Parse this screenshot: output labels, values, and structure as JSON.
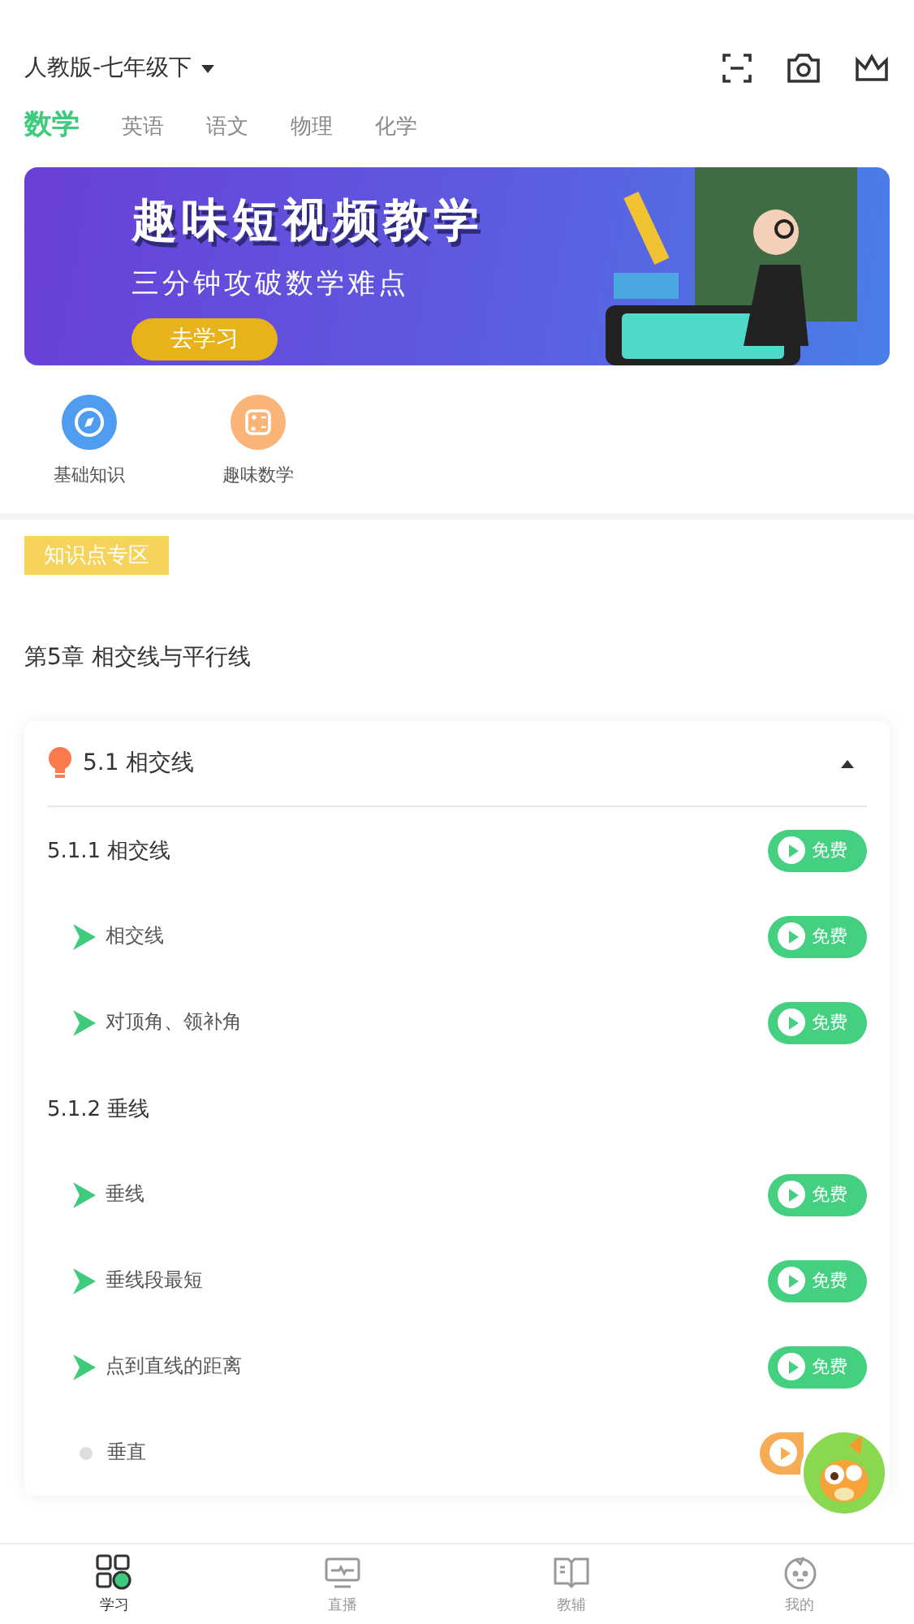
{
  "header": {
    "textbook": "人教版-七年级下"
  },
  "subjects": [
    {
      "label": "数学",
      "selected": true
    },
    {
      "label": "英语",
      "selected": false
    },
    {
      "label": "语文",
      "selected": false
    },
    {
      "label": "物理",
      "selected": false
    },
    {
      "label": "化学",
      "selected": false
    }
  ],
  "banner": {
    "title": "趣味短视频教学",
    "subtitle": "三分钟攻破数学难点",
    "button": "去学习"
  },
  "shortcuts": [
    {
      "label": "基础知识",
      "kind": "compass"
    },
    {
      "label": "趣味数学",
      "kind": "calculator"
    }
  ],
  "section_tag": "知识点专区",
  "chapter_title": "第5章 相交线与平行线",
  "section": {
    "title": "5.1 相交线",
    "expanded": true,
    "subsections": [
      {
        "title": "5.1.1 相交线",
        "badge": {
          "kind": "free",
          "label": "免费"
        },
        "children": [
          {
            "title": "相交线",
            "badge": {
              "kind": "free",
              "label": "免费"
            }
          },
          {
            "title": "对顶角、领补角",
            "badge": {
              "kind": "free",
              "label": "免费"
            }
          }
        ]
      },
      {
        "title": "5.1.2 垂线",
        "children": [
          {
            "title": "垂线",
            "badge": {
              "kind": "free",
              "label": "免费"
            }
          },
          {
            "title": "垂线段最短",
            "badge": {
              "kind": "free",
              "label": "免费"
            }
          },
          {
            "title": "点到直线的距离",
            "badge": {
              "kind": "free",
              "label": "免费"
            }
          },
          {
            "title": "垂直",
            "badge": {
              "kind": "vip"
            }
          }
        ]
      }
    ]
  },
  "nav": [
    {
      "label": "学习",
      "kind": "study",
      "selected": true
    },
    {
      "label": "直播",
      "kind": "live",
      "selected": false
    },
    {
      "label": "教辅",
      "kind": "book",
      "selected": false
    },
    {
      "label": "我的",
      "kind": "profile",
      "selected": false
    }
  ]
}
